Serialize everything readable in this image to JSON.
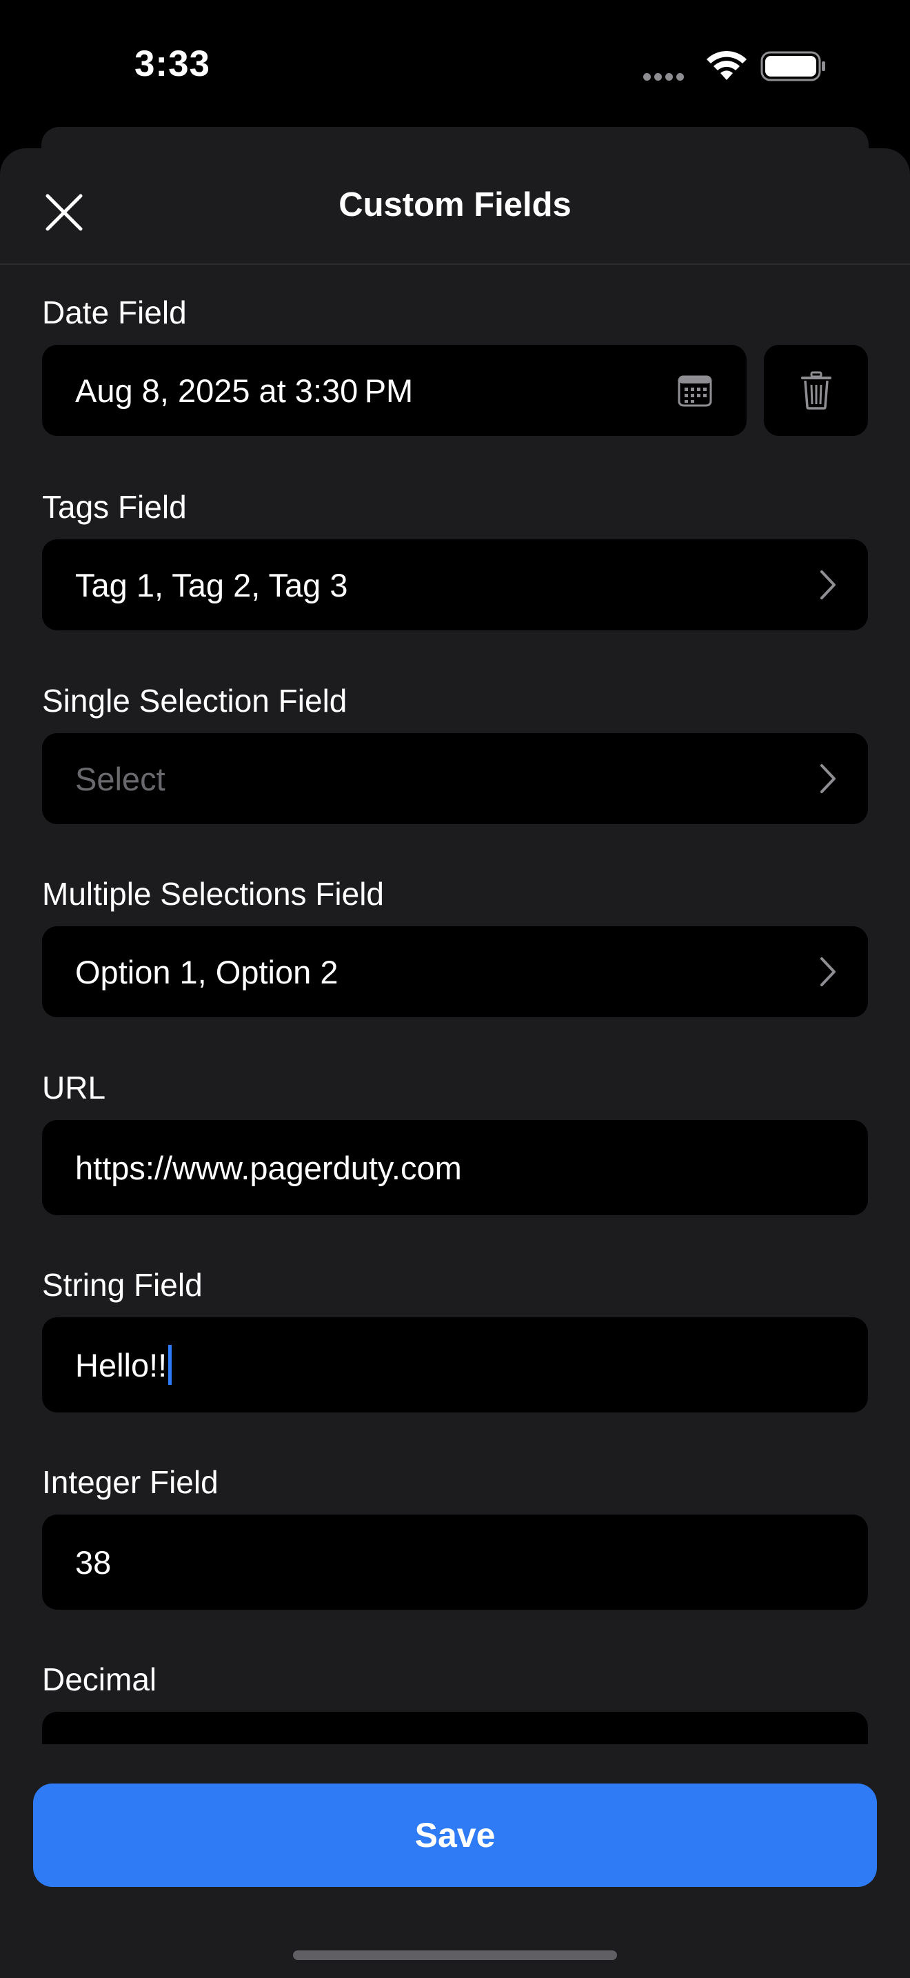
{
  "status_bar": {
    "time": "3:33",
    "icons": [
      "signal-dots-icon",
      "wifi-icon",
      "battery-icon"
    ]
  },
  "sheet": {
    "title": "Custom Fields",
    "close_icon": "close-icon"
  },
  "fields": {
    "date": {
      "label": "Date Field",
      "value": "Aug 8, 2025 at 3:30 PM",
      "icon": "calendar-icon",
      "delete_icon": "trash-icon"
    },
    "tags": {
      "label": "Tags Field",
      "value": "Tag 1, Tag 2, Tag 3"
    },
    "single_selection": {
      "label": "Single Selection Field",
      "placeholder": "Select"
    },
    "multiple_selections": {
      "label": "Multiple Selections Field",
      "value": "Option 1, Option 2"
    },
    "url": {
      "label": "URL",
      "value": "https://www.pagerduty.com"
    },
    "string": {
      "label": "String Field",
      "value": "Hello!!"
    },
    "integer": {
      "label": "Integer Field",
      "value": "38"
    },
    "decimal": {
      "label": "Decimal"
    }
  },
  "footer": {
    "save_label": "Save"
  },
  "colors": {
    "background": "#000000",
    "sheet": "#1c1c1e",
    "field": "#000000",
    "accent": "#2f7bf5",
    "placeholder": "#6a6a6e"
  }
}
